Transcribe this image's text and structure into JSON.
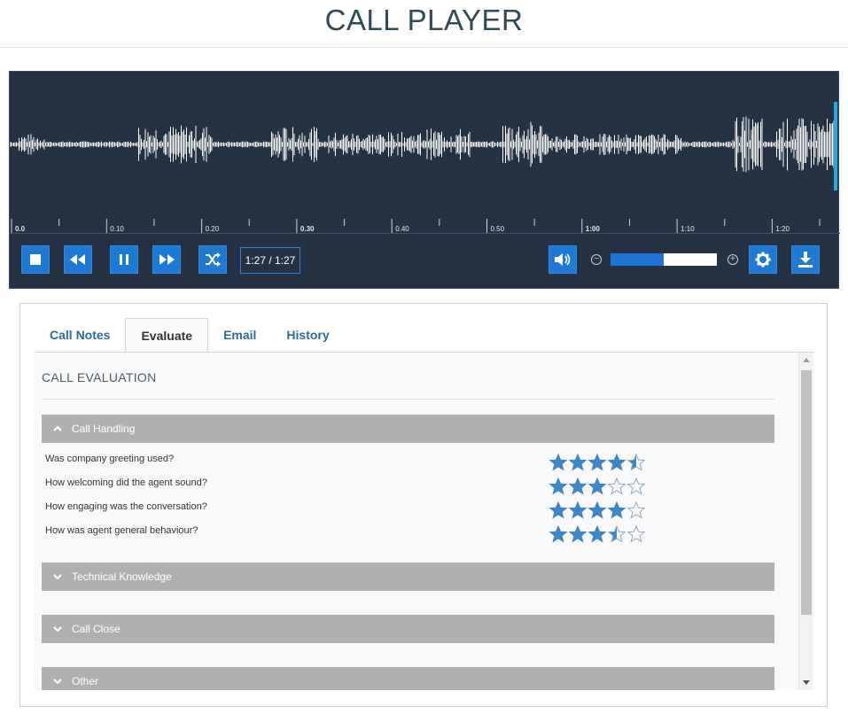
{
  "page": {
    "title": "CALL PLAYER"
  },
  "player": {
    "time_display": "1:27 / 1:27",
    "timeline_labels": [
      "0.0",
      "0.10",
      "0.20",
      "0.30",
      "0.40",
      "0.50",
      "1:00",
      "1:10",
      "1:20"
    ],
    "controls": [
      "stop-icon",
      "rewind-icon",
      "pause-icon",
      "fast-forward-icon",
      "shuffle-icon"
    ],
    "volume_icon": "volume-icon",
    "zoom_level": 0.5,
    "settings_icon": "gear-icon",
    "download_icon": "download-icon",
    "accent_color": "#1e7ad2",
    "background_color": "#243244"
  },
  "tabs": [
    {
      "label": "Call Notes",
      "active": false
    },
    {
      "label": "Evaluate",
      "active": true
    },
    {
      "label": "Email",
      "active": false
    },
    {
      "label": "History",
      "active": false
    }
  ],
  "evaluation": {
    "title": "CALL EVALUATION",
    "sections": [
      {
        "label": "Call Handling",
        "expanded": true,
        "questions": [
          {
            "text": "Was company greeting used?",
            "rating": 4.5,
            "max": 5
          },
          {
            "text": "How welcoming did the agent sound?",
            "rating": 3,
            "max": 5
          },
          {
            "text": "How engaging was the conversation?",
            "rating": 4,
            "max": 5
          },
          {
            "text": "How was agent general behaviour?",
            "rating": 3.5,
            "max": 5
          }
        ]
      },
      {
        "label": "Technical Knowledge",
        "expanded": false
      },
      {
        "label": "Call Close",
        "expanded": false
      },
      {
        "label": "Other",
        "expanded": false
      }
    ]
  }
}
